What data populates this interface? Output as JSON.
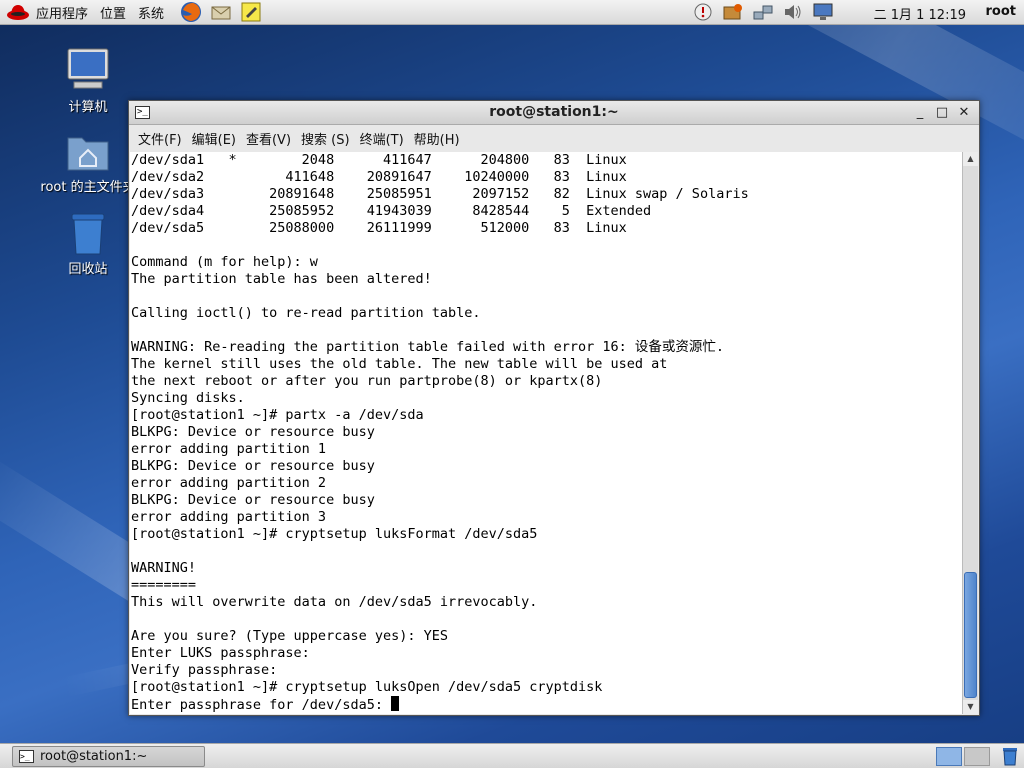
{
  "top_panel": {
    "menus": [
      "应用程序",
      "位置",
      "系统"
    ],
    "launchers": [
      "firefox-icon",
      "mail-icon",
      "notes-icon"
    ],
    "tray": [
      "update-icon",
      "package-icon",
      "network-icon",
      "volume-icon",
      "display-icon"
    ],
    "clock": "二 1月  1 12:19",
    "user": "root"
  },
  "desktop": {
    "icons": [
      {
        "label": "计算机",
        "icon": "computer-icon"
      },
      {
        "label": "root 的主文件夹",
        "icon": "home-folder-icon"
      },
      {
        "label": "回收站",
        "icon": "trash-icon"
      }
    ]
  },
  "window": {
    "title": "root@station1:~",
    "menu": [
      "文件(F)",
      "编辑(E)",
      "查看(V)",
      "搜索 (S)",
      "终端(T)",
      "帮助(H)"
    ],
    "lines": [
      "/dev/sda1   *        2048      411647      204800   83  Linux",
      "/dev/sda2          411648    20891647    10240000   83  Linux",
      "/dev/sda3        20891648    25085951     2097152   82  Linux swap / Solaris",
      "/dev/sda4        25085952    41943039     8428544    5  Extended",
      "/dev/sda5        25088000    26111999      512000   83  Linux",
      "",
      "Command (m for help): w",
      "The partition table has been altered!",
      "",
      "Calling ioctl() to re-read partition table.",
      "",
      "WARNING: Re-reading the partition table failed with error 16: 设备或资源忙.",
      "The kernel still uses the old table. The new table will be used at",
      "the next reboot or after you run partprobe(8) or kpartx(8)",
      "Syncing disks.",
      "[root@station1 ~]# partx -a /dev/sda",
      "BLKPG: Device or resource busy",
      "error adding partition 1",
      "BLKPG: Device or resource busy",
      "error adding partition 2",
      "BLKPG: Device or resource busy",
      "error adding partition 3",
      "[root@station1 ~]# cryptsetup luksFormat /dev/sda5",
      "",
      "WARNING!",
      "========",
      "This will overwrite data on /dev/sda5 irrevocably.",
      "",
      "Are you sure? (Type uppercase yes): YES",
      "Enter LUKS passphrase:",
      "Verify passphrase:",
      "[root@station1 ~]# cryptsetup luksOpen /dev/sda5 cryptdisk",
      "Enter passphrase for /dev/sda5: "
    ]
  },
  "taskbar": {
    "task_label": "root@station1:~"
  }
}
